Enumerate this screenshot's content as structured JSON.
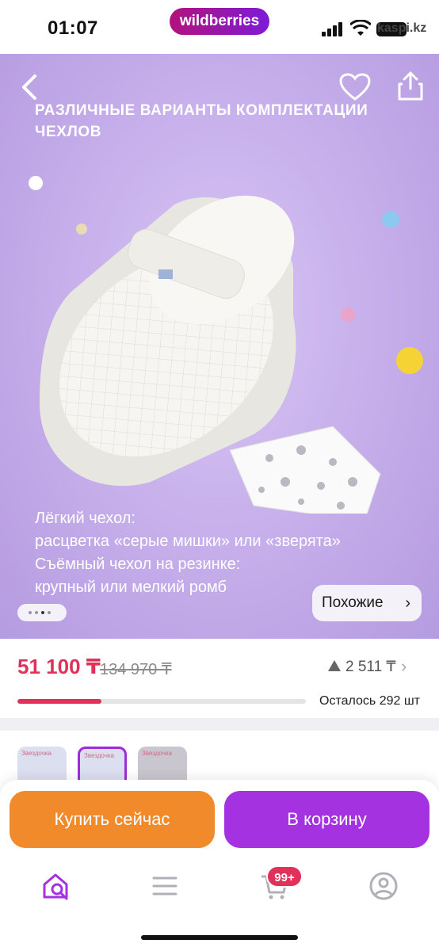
{
  "status_bar": {
    "time": "01:07",
    "app_badge": "wildberries",
    "watermark": "kaspi.kz"
  },
  "hero": {
    "header": "РАЗЛИЧНЫЕ ВАРИАНТЫ КОМПЛЕКТАЦИИ ЧЕХЛОВ",
    "caption_lines": [
      "Лёгкий чехол:",
      "расцветка «серые мишки» или «зверята»",
      "Съёмный чехол на резинке:",
      "крупный или мелкий ромб"
    ],
    "similar_label": "Похожие",
    "pager_count": 4,
    "pager_active": 2
  },
  "price": {
    "current": "51 100 ₸",
    "old": "134 970 ₸",
    "drop": "2 511 ₸",
    "stock_text": "Осталось 292 шт",
    "stock_fraction": 0.29
  },
  "thumbnails": [
    {
      "label": "Звездочка"
    },
    {
      "label": "Звездочка",
      "selected": true
    },
    {
      "label": "Звездочка"
    }
  ],
  "actions": {
    "buy_now": "Купить сейчас",
    "to_cart": "В корзину"
  },
  "bottom_nav": {
    "cart_badge": "99+",
    "items": [
      "home-search-icon",
      "menu-icon",
      "cart-icon",
      "profile-icon"
    ]
  },
  "colors": {
    "price_red": "#e0315a",
    "brand_purple": "#a432e0",
    "buy_orange": "#f08a2a",
    "hero_lilac": "#c8b1ec"
  }
}
